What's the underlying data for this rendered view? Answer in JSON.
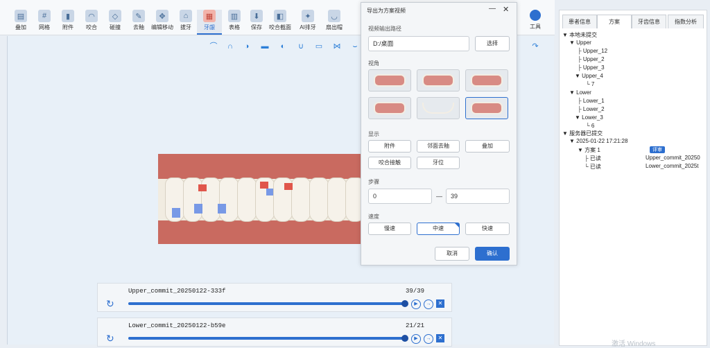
{
  "toolbar": {
    "items": [
      {
        "label": "叠加",
        "icon": "stack-icon"
      },
      {
        "label": "网格",
        "icon": "grid-icon"
      },
      {
        "label": "附件",
        "icon": "attachment-icon"
      },
      {
        "label": "咬合",
        "icon": "bite-icon"
      },
      {
        "label": "碰撞",
        "icon": "collision-icon"
      },
      {
        "label": "去釉",
        "icon": "ipr-icon"
      },
      {
        "label": "编辑移动",
        "icon": "move-icon"
      },
      {
        "label": "拔牙",
        "icon": "extract-icon"
      },
      {
        "label": "牙龈",
        "icon": "gum-icon"
      },
      {
        "label": "表格",
        "icon": "table-icon"
      },
      {
        "label": "保存",
        "icon": "save-icon"
      },
      {
        "label": "咬合截面",
        "icon": "section-icon"
      },
      {
        "label": "AI排牙",
        "icon": "ai-icon"
      },
      {
        "label": "扇出帽",
        "icon": "cap-icon"
      }
    ],
    "tools_label": "工具"
  },
  "dialog": {
    "title": "导出为方案视频",
    "path_section": "视频输出路径",
    "path_value": "D:/桌面",
    "choose_button": "选择",
    "view_section": "视角",
    "display_section": "显示",
    "display_buttons": [
      "附件",
      "邻面去釉",
      "叠加",
      "咬合接触",
      "牙位"
    ],
    "steps_section": "步骤",
    "step_from": "0",
    "step_to": "39",
    "speed_section": "速度",
    "speed_buttons": [
      "慢速",
      "中速",
      "快速"
    ],
    "cancel_button": "取消",
    "confirm_button": "确认"
  },
  "right_panel": {
    "tabs": [
      "患者信息",
      "方案",
      "牙齿信息",
      "指数分析"
    ],
    "tree": [
      {
        "text": "本地未提交"
      },
      {
        "text": "Upper"
      },
      {
        "text": "Upper_12"
      },
      {
        "text": "Upper_2"
      },
      {
        "text": "Upper_3"
      },
      {
        "text": "Upper_4"
      },
      {
        "text": "7"
      },
      {
        "text": "Lower"
      },
      {
        "text": "Lower_1"
      },
      {
        "text": "Lower_2"
      },
      {
        "text": "Lower_3"
      },
      {
        "text": "6"
      },
      {
        "text": "服务器已提交"
      },
      {
        "text": "2025-01-22 17:21:28"
      },
      {
        "text": "方案 1"
      },
      {
        "text": "已读"
      },
      {
        "text": "已读"
      }
    ],
    "tag": "评审",
    "commit_upper": "Upper_commit_20250",
    "commit_lower": "Lower_commit_2025t"
  },
  "players": [
    {
      "name": "Upper_commit_20250122-333f",
      "count": "39/39",
      "progress": 1.0
    },
    {
      "name": "Lower_commit_20250122-b59e",
      "count": "21/21",
      "progress": 1.0
    }
  ],
  "watermark": "激活 Windows"
}
